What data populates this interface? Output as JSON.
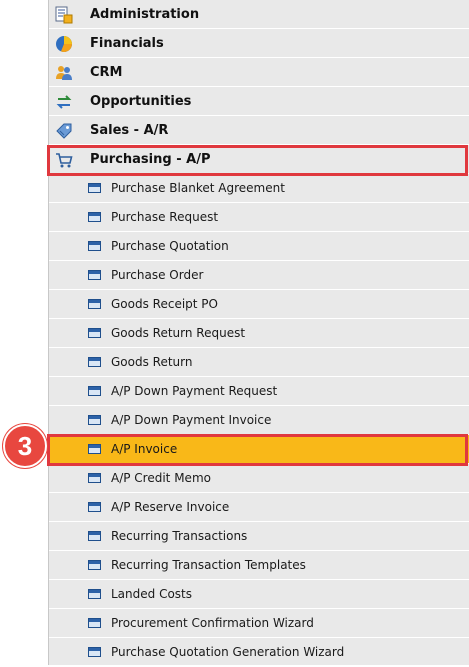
{
  "menu": {
    "categories": [
      {
        "label": "Administration",
        "icon": "administration-icon"
      },
      {
        "label": "Financials",
        "icon": "financials-pie-icon"
      },
      {
        "label": "CRM",
        "icon": "crm-people-icon"
      },
      {
        "label": "Opportunities",
        "icon": "opportunities-icon"
      },
      {
        "label": "Sales - A/R",
        "icon": "sales-tag-icon"
      },
      {
        "label": "Purchasing - A/P",
        "icon": "purchasing-cart-icon"
      }
    ],
    "purchasing_items": [
      {
        "label": "Purchase Blanket Agreement"
      },
      {
        "label": "Purchase Request"
      },
      {
        "label": "Purchase Quotation"
      },
      {
        "label": "Purchase Order"
      },
      {
        "label": "Goods Receipt PO"
      },
      {
        "label": "Goods Return Request"
      },
      {
        "label": "Goods Return"
      },
      {
        "label": "A/P Down Payment Request"
      },
      {
        "label": "A/P Down Payment Invoice"
      },
      {
        "label": "A/P Invoice",
        "selected": true
      },
      {
        "label": "A/P Credit Memo"
      },
      {
        "label": "A/P Reserve Invoice"
      },
      {
        "label": "Recurring Transactions"
      },
      {
        "label": "Recurring Transaction Templates"
      },
      {
        "label": "Landed Costs"
      },
      {
        "label": "Procurement Confirmation Wizard"
      },
      {
        "label": "Purchase Quotation Generation Wizard"
      }
    ]
  },
  "annotations": {
    "step_number": "3"
  },
  "colors": {
    "selection": "#f9b818",
    "highlight": "#e0383e",
    "panel": "#e9e9e9"
  }
}
